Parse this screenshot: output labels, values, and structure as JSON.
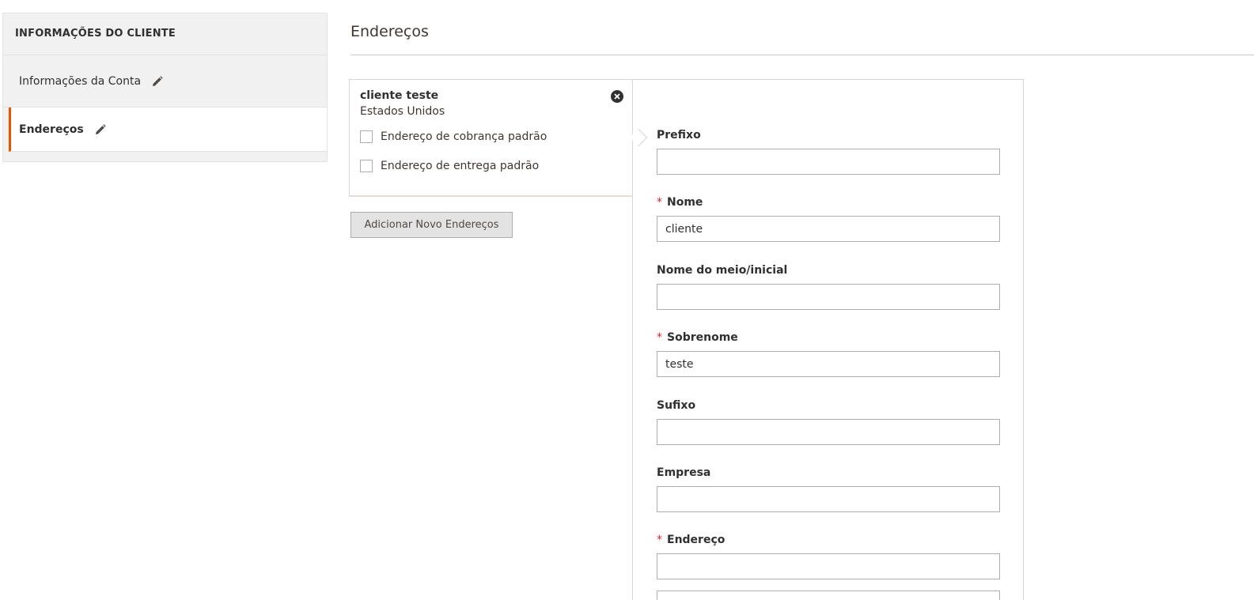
{
  "sidebar": {
    "title": "INFORMAÇÕES DO CLIENTE",
    "items": [
      {
        "label": "Informações da Conta",
        "icon": "pencil-icon"
      },
      {
        "label": "Endereços",
        "icon": "pencil-icon",
        "active": true
      }
    ]
  },
  "section": {
    "title": "Endereços"
  },
  "address_card": {
    "name": "cliente teste",
    "country": "Estados Unidos",
    "default_billing_label": "Endereço de cobrança padrão",
    "default_shipping_label": "Endereço de entrega padrão",
    "default_billing_checked": false,
    "default_shipping_checked": false
  },
  "add_button_label": "Adicionar Novo Endereços",
  "form": {
    "prefix": {
      "label": "Prefixo",
      "value": ""
    },
    "first_name": {
      "label": "Nome",
      "value": "cliente",
      "required": true
    },
    "middle_name": {
      "label": "Nome do meio/inicial",
      "value": ""
    },
    "last_name": {
      "label": "Sobrenome",
      "value": "teste",
      "required": true
    },
    "suffix": {
      "label": "Sufixo",
      "value": ""
    },
    "company": {
      "label": "Empresa",
      "value": ""
    },
    "street": {
      "label": "Endereço",
      "value": "",
      "required": true
    }
  },
  "colors": {
    "accent": "#eb5202",
    "required": "#e22626"
  }
}
